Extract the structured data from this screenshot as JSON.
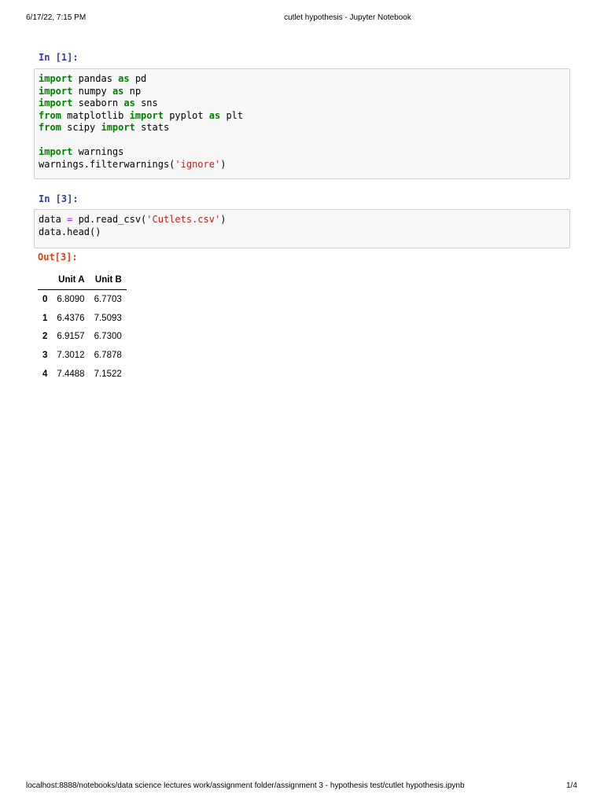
{
  "header": {
    "datetime": "6/17/22, 7:15 PM",
    "title": "cutlet hypothesis - Jupyter Notebook"
  },
  "cells": [
    {
      "prompt": "In [1]:",
      "lines": [
        [
          [
            "import",
            "kw"
          ],
          [
            " pandas ",
            ""
          ],
          [
            "as",
            "kw"
          ],
          [
            " pd",
            ""
          ]
        ],
        [
          [
            "import",
            "kw"
          ],
          [
            " numpy ",
            ""
          ],
          [
            "as",
            "kw"
          ],
          [
            " np",
            ""
          ]
        ],
        [
          [
            "import",
            "kw"
          ],
          [
            " seaborn ",
            ""
          ],
          [
            "as",
            "kw"
          ],
          [
            " sns",
            ""
          ]
        ],
        [
          [
            "from",
            "kw"
          ],
          [
            " matplotlib ",
            ""
          ],
          [
            "import",
            "kw"
          ],
          [
            " pyplot ",
            ""
          ],
          [
            "as",
            "kw"
          ],
          [
            " plt",
            ""
          ]
        ],
        [
          [
            "from",
            "kw"
          ],
          [
            " scipy ",
            ""
          ],
          [
            "import",
            "kw"
          ],
          [
            " stats",
            ""
          ]
        ],
        [],
        [
          [
            "import",
            "kw"
          ],
          [
            " warnings",
            ""
          ]
        ],
        [
          [
            "warnings.filterwarnings(",
            ""
          ],
          [
            "'ignore'",
            "str"
          ],
          [
            ")",
            ""
          ]
        ]
      ]
    },
    {
      "prompt": "In [3]:",
      "lines": [
        [
          [
            "data ",
            ""
          ],
          [
            "=",
            "op"
          ],
          [
            " pd.read_csv(",
            ""
          ],
          [
            "'Cutlets.csv'",
            "str"
          ],
          [
            ")",
            ""
          ]
        ],
        [
          [
            "data.head()",
            ""
          ]
        ]
      ]
    }
  ],
  "output": {
    "prompt": "Out[3]:",
    "columns": [
      "",
      "Unit A",
      "Unit B"
    ],
    "rows": [
      [
        "0",
        "6.8090",
        "6.7703"
      ],
      [
        "1",
        "6.4376",
        "7.5093"
      ],
      [
        "2",
        "6.9157",
        "6.7300"
      ],
      [
        "3",
        "7.3012",
        "6.7878"
      ],
      [
        "4",
        "7.4488",
        "7.1522"
      ]
    ]
  },
  "footer": {
    "url": "localhost:8888/notebooks/data science lectures work/assignment folder/assignment 3 - hypothesis test/cutlet hypothesis.ipynb",
    "page": "1/4"
  }
}
